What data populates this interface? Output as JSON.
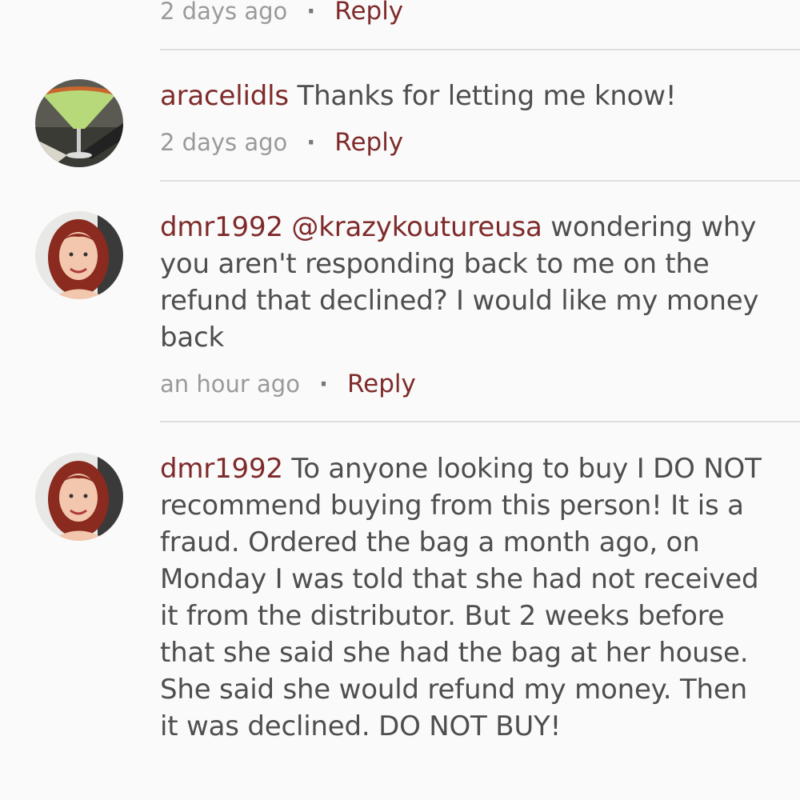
{
  "comments": [
    {
      "time": "2 days ago",
      "reply_label": "Reply"
    },
    {
      "username": "aracelidls",
      "text": "Thanks for letting me know!",
      "time": "2 days ago",
      "reply_label": "Reply",
      "avatar_icon": "martini-glass-photo"
    },
    {
      "username": "dmr1992",
      "mention": "@krazykoutureusa",
      "text": "wondering why you aren't responding back to me on the refund that declined? I would like my money back",
      "time": "an hour ago",
      "reply_label": "Reply",
      "avatar_icon": "profile-photo-woman"
    },
    {
      "username": "dmr1992",
      "text": "To anyone looking to buy I DO NOT recommend buying from this person! It is a fraud. Ordered the bag a month ago, on Monday I was told that she had not received it from the distributor. But 2 weeks before that she said she had the bag at her house. She said she would refund my money. Then it was declined. DO NOT BUY!",
      "avatar_icon": "profile-photo-woman"
    }
  ],
  "colors": {
    "username": "#7f2a2a",
    "body_text": "#4e4e4e",
    "meta_text": "#9a9a9a",
    "divider": "#dedede",
    "background": "#fafafa"
  }
}
